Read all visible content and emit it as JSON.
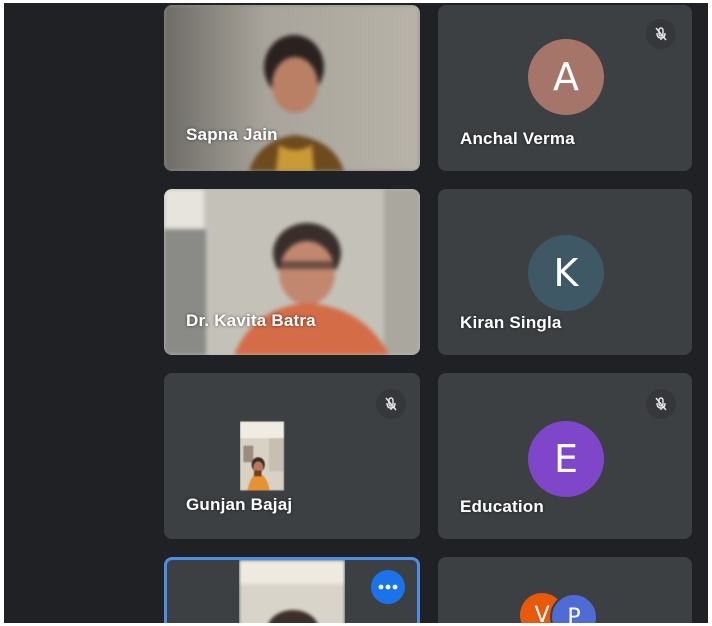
{
  "colors": {
    "background": "#202124",
    "tile": "#3c4043",
    "avatar_anchal": "#a5756a",
    "avatar_kiran": "#3f5866",
    "avatar_education": "#8046c9",
    "avatar_v": "#e8590c",
    "avatar_p": "#4f6bd6",
    "active_border": "#4d8fe7",
    "more_button": "#1a73e8"
  },
  "participants": [
    {
      "name": "Sapna Jain",
      "type": "video",
      "muted": false
    },
    {
      "name": "Anchal Verma",
      "type": "avatar",
      "initial": "A",
      "muted": true
    },
    {
      "name": "Dr. Kavita Batra",
      "type": "video",
      "muted": false
    },
    {
      "name": "Kiran Singla",
      "type": "avatar",
      "initial": "K",
      "muted": false
    },
    {
      "name": "Gunjan Bajaj",
      "type": "video",
      "muted": true
    },
    {
      "name": "Education",
      "type": "avatar",
      "initial": "E",
      "muted": true
    },
    {
      "name": "",
      "type": "video",
      "active": true,
      "more_options": "mic-more-icon"
    },
    {
      "name": "",
      "type": "avatar-group",
      "initials": [
        "V",
        "P"
      ]
    }
  ],
  "labels": {
    "gunjan_visible": "Gunjan Bajaj"
  }
}
